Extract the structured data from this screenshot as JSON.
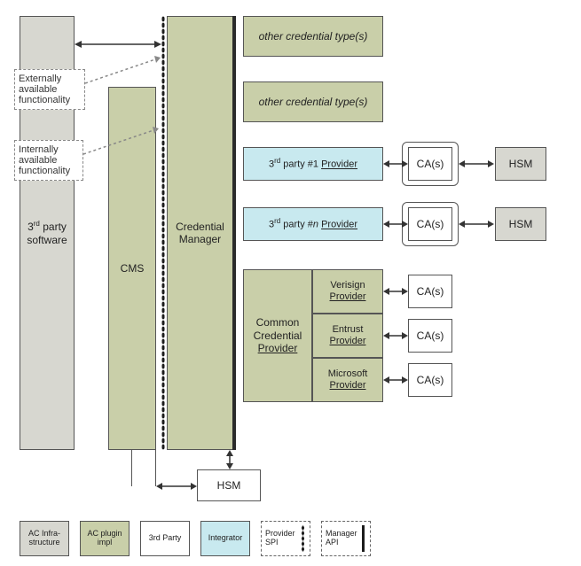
{
  "columns": {
    "third_party_software": "3rd party software",
    "cms": "CMS",
    "credential_manager": "Credential Manager"
  },
  "notes": {
    "external": "Externally available functionality",
    "internal": "Internally available functionality"
  },
  "top_boxes": [
    "other credential type(s)",
    "other credential type(s)"
  ],
  "third_party_rows": [
    {
      "provider_html": "3<sup>rd</sup> party #1 <span class='underline'>Provider</span>",
      "ca": "CA(s)",
      "hsm": "HSM"
    },
    {
      "provider_html": "3<sup>rd</sup> party #<i>n</i> <span class='underline'>Provider</span>",
      "ca": "CA(s)",
      "hsm": "HSM"
    }
  ],
  "common_provider": {
    "label_line1": "Common",
    "label_line2": "Credential",
    "label_line3": "Provider",
    "providers": [
      {
        "name_line1": "Verisign",
        "name_line2": "Provider",
        "ca": "CA(s)"
      },
      {
        "name_line1": "Entrust",
        "name_line2": "Provider",
        "ca": "CA(s)"
      },
      {
        "name_line1": "Microsoft",
        "name_line2": "Provider",
        "ca": "CA(s)"
      }
    ]
  },
  "bottom_hsm": "HSM",
  "legend": {
    "ac_infra": "AC Infra- structure",
    "ac_plugin": "AC plugin impl",
    "third_party": "3rd Party",
    "integrator": "Integrator",
    "provider_spi": "Provider SPI",
    "manager_api": "Manager API"
  }
}
